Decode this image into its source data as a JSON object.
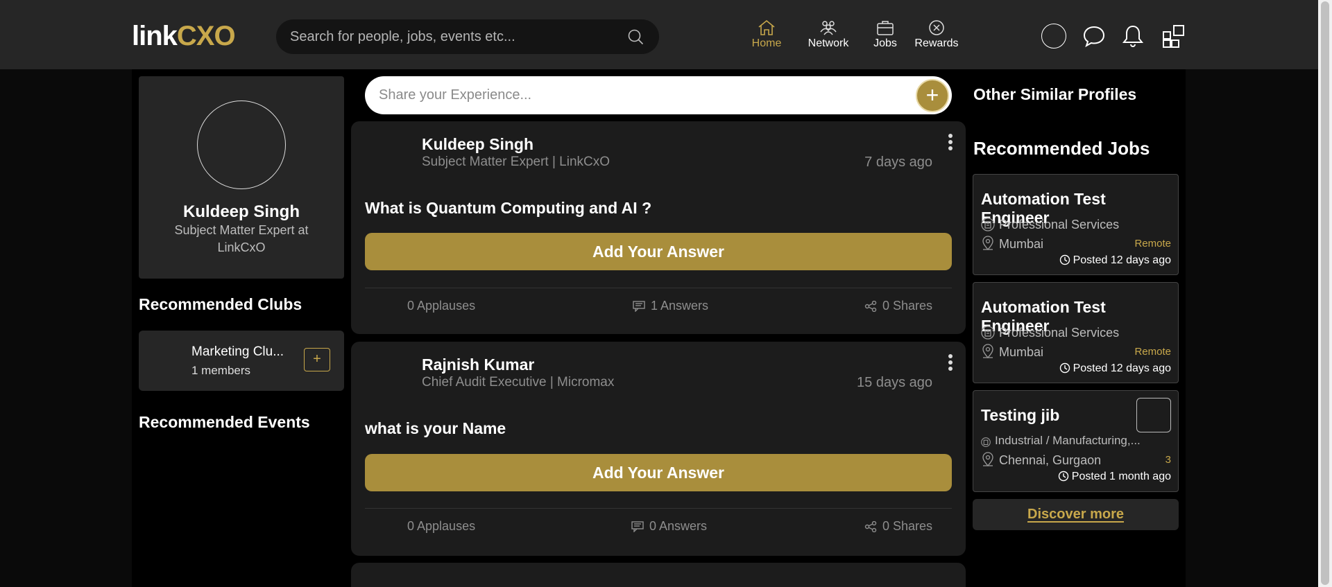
{
  "header": {
    "logo": {
      "part1": "link",
      "part2": "CXO"
    },
    "search_placeholder": "Search for people, jobs, events etc...",
    "nav": [
      {
        "label": "Home",
        "icon": "home-icon",
        "active": true
      },
      {
        "label": "Network",
        "icon": "network-icon",
        "active": false
      },
      {
        "label": "Jobs",
        "icon": "briefcase-icon",
        "active": false
      },
      {
        "label": "Rewards",
        "icon": "rewards-icon",
        "active": false
      }
    ],
    "accent_color": "#c8a84b"
  },
  "profile": {
    "name": "Kuldeep Singh",
    "title": "Subject Matter Expert at LinkCxO"
  },
  "left": {
    "clubs_title": "Recommended Clubs",
    "clubs": [
      {
        "name": "Marketing Clu...",
        "members": "1 members",
        "add": "+"
      }
    ],
    "events_title": "Recommended Events"
  },
  "share": {
    "placeholder": "Share your Experience...",
    "plus": "+"
  },
  "posts": [
    {
      "author": "Kuldeep Singh",
      "role": "Subject Matter Expert | LinkCxO",
      "time": "7 days ago",
      "question": "What is Quantum Computing and AI ?",
      "answer_label": "Add Your Answer",
      "applauses": "0 Applauses",
      "answers": "1 Answers",
      "shares": "0 Shares"
    },
    {
      "author": "Rajnish Kumar",
      "role": "Chief Audit Executive | Micromax",
      "time": "15 days ago",
      "question": "what is your Name",
      "answer_label": "Add Your Answer",
      "applauses": "0 Applauses",
      "answers": "0 Answers",
      "shares": "0 Shares"
    }
  ],
  "right": {
    "similar_title": "Other Similar Profiles",
    "jobs_title": "Recommended Jobs",
    "jobs": [
      {
        "title": "Automation Test Engineer",
        "industry": "Professional Services",
        "location": "Mumbai",
        "tag": "Remote",
        "posted": "Posted 12 days ago"
      },
      {
        "title": "Automation Test Engineer",
        "industry": "Professional Services",
        "location": "Mumbai",
        "tag": "Remote",
        "posted": "Posted 12 days ago"
      },
      {
        "title": "Testing jib",
        "industry": "Industrial / Manufacturing,...",
        "location": "Chennai, Gurgaon",
        "tag": "3",
        "posted": "Posted 1 month ago"
      }
    ],
    "discover": "Discover more"
  }
}
